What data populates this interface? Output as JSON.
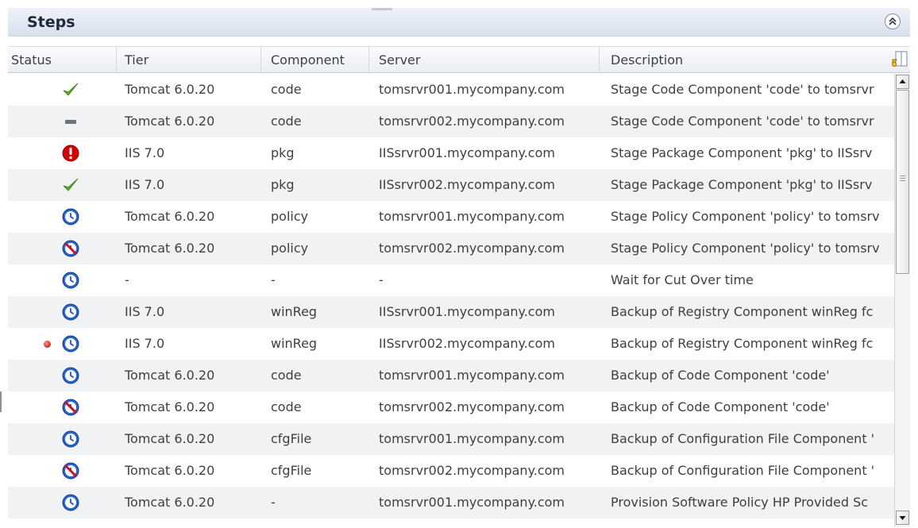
{
  "panel": {
    "title": "Steps"
  },
  "columns": [
    "Status",
    "Tier",
    "Component",
    "Server",
    "Description"
  ],
  "icons": {
    "collapse": "double-chevron-up-icon",
    "column_config": "column-settings-icon",
    "scroll_up": "triangle-up-icon",
    "scroll_down": "triangle-down-icon"
  },
  "colors": {
    "success": "#5bb02a",
    "error": "#d40000",
    "scheduled": "#2a64c8",
    "skipped": "#c8102e",
    "neutral": "#6d7480"
  },
  "rows": [
    {
      "status": "success",
      "tier": "Tomcat 6.0.20",
      "component": "code",
      "server": "tomsrvr001.mycompany.com",
      "description": "Stage Code Component 'code' to tomsrvr"
    },
    {
      "status": "not-run",
      "tier": "Tomcat 6.0.20",
      "component": "code",
      "server": "tomsrvr002.mycompany.com",
      "description": "Stage Code Component 'code' to tomsrvr"
    },
    {
      "status": "error",
      "tier": "IIS 7.0",
      "component": "pkg",
      "server": "IISsrvr001.mycompany.com",
      "description": "Stage Package Component 'pkg' to IISsrv"
    },
    {
      "status": "success",
      "tier": "IIS 7.0",
      "component": "pkg",
      "server": "IISsrvr002.mycompany.com",
      "description": "Stage Package Component 'pkg' to IISsrv"
    },
    {
      "status": "scheduled",
      "tier": "Tomcat 6.0.20",
      "component": "policy",
      "server": "tomsrvr001.mycompany.com",
      "description": "Stage Policy Component 'policy' to tomsrv"
    },
    {
      "status": "blocked",
      "tier": "Tomcat 6.0.20",
      "component": "policy",
      "server": "tomsrvr002.mycompany.com",
      "description": "Stage Policy Component 'policy' to tomsrv"
    },
    {
      "status": "scheduled",
      "tier": "-",
      "component": "-",
      "server": "-",
      "description": "Wait for Cut Over time"
    },
    {
      "status": "scheduled",
      "tier": "IIS 7.0",
      "component": "winReg",
      "server": "IISsrvr001.mycompany.com",
      "description": "Backup of Registry Component winReg fc"
    },
    {
      "status": "scheduled",
      "marker": true,
      "tier": "IIS 7.0",
      "component": "winReg",
      "server": "IISsrvr002.mycompany.com",
      "description": "Backup of Registry Component winReg fc"
    },
    {
      "status": "scheduled",
      "tier": "Tomcat 6.0.20",
      "component": "code",
      "server": "tomsrvr001.mycompany.com",
      "description": "Backup of Code Component 'code'"
    },
    {
      "status": "blocked",
      "tier": "Tomcat 6.0.20",
      "component": "code",
      "server": "tomsrvr002.mycompany.com",
      "description": "Backup of Code Component 'code'"
    },
    {
      "status": "scheduled",
      "tier": "Tomcat 6.0.20",
      "component": "cfgFile",
      "server": "tomsrvr001.mycompany.com",
      "description": "Backup of Configuration File Component '"
    },
    {
      "status": "blocked",
      "tier": "Tomcat 6.0.20",
      "component": "cfgFile",
      "server": "tomsrvr002.mycompany.com",
      "description": "Backup of Configuration File Component '"
    },
    {
      "status": "scheduled",
      "tier": "Tomcat 6.0.20",
      "component": "-",
      "server": "tomsrvr001.mycompany.com",
      "description": "Provision Software Policy HP Provided Sc"
    }
  ]
}
